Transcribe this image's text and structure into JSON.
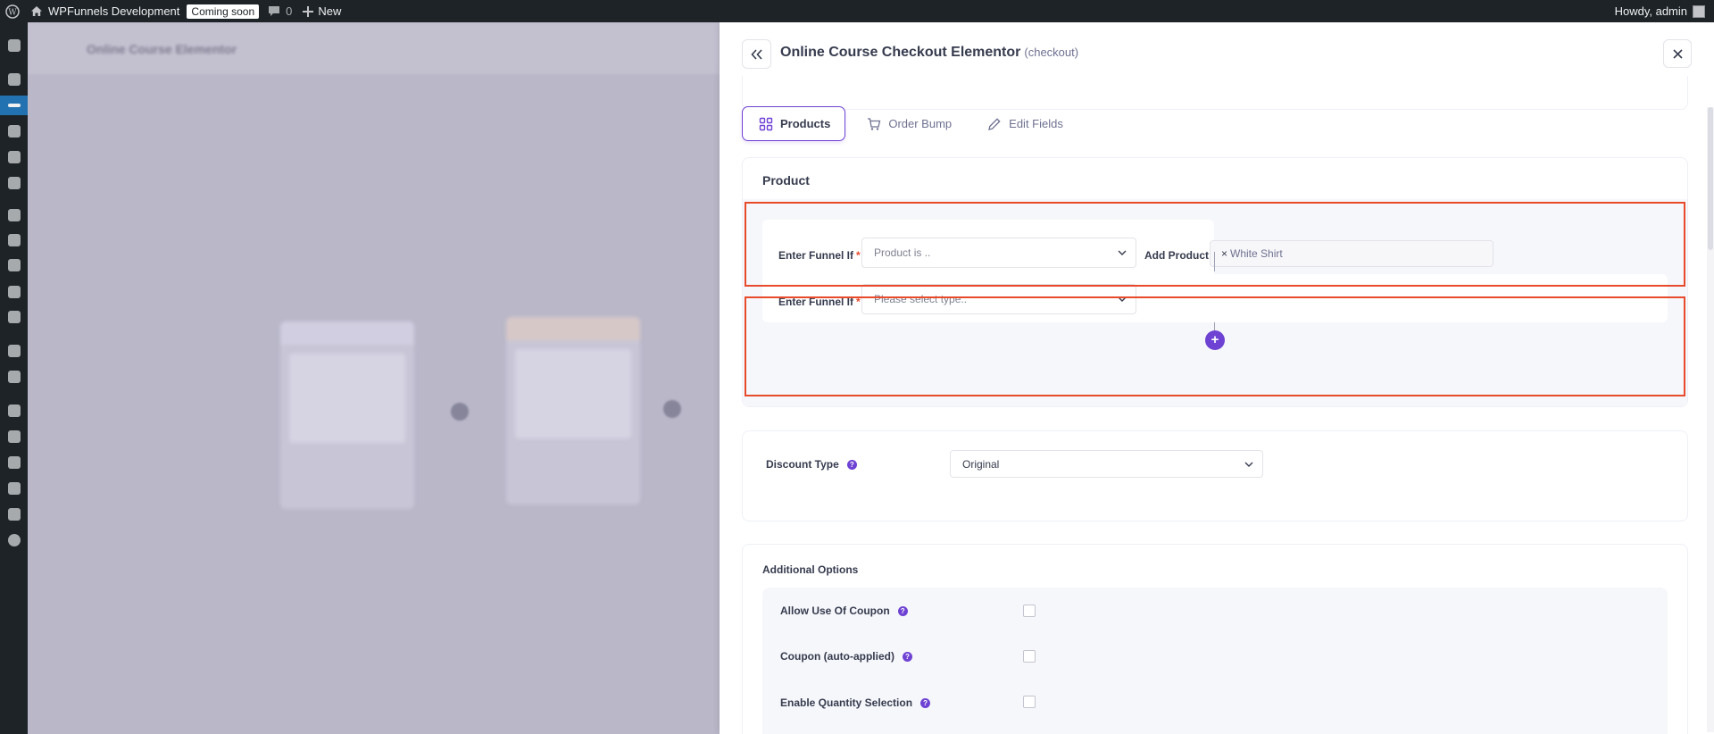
{
  "admin_bar": {
    "site_name": "WPFunnels Development",
    "coming_soon": "Coming soon",
    "comments_count": "0",
    "new_label": "New",
    "greeting": "Howdy, admin"
  },
  "canvas": {
    "title": "Online Course Elementor"
  },
  "drawer": {
    "title": "Online Course Checkout Elementor",
    "subtitle": "(checkout)",
    "tabs": [
      {
        "label": "Products",
        "icon": "grid-icon"
      },
      {
        "label": "Order Bump",
        "icon": "cart-icon"
      },
      {
        "label": "Edit Fields",
        "icon": "pencil-icon"
      }
    ],
    "product": {
      "heading": "Product",
      "condition_1": {
        "label": "Enter Funnel If",
        "select_value": "Product is ..",
        "add_product_label": "Add Product",
        "tag": "White Shirt"
      },
      "condition_2": {
        "label": "Enter Funnel If",
        "select_placeholder": "Please select type.."
      },
      "add_button": "+"
    },
    "discount": {
      "label": "Discount Type",
      "value": "Original"
    },
    "additional_options": {
      "heading": "Additional Options",
      "items": [
        {
          "label": "Allow Use Of Coupon",
          "checked": false
        },
        {
          "label": "Coupon (auto-applied)",
          "checked": false
        },
        {
          "label": "Enable Quantity Selection",
          "checked": false
        }
      ]
    }
  },
  "colors": {
    "accent": "#6e42d3",
    "highlight": "#e84a2c",
    "admin_bar": "#1d2327"
  }
}
